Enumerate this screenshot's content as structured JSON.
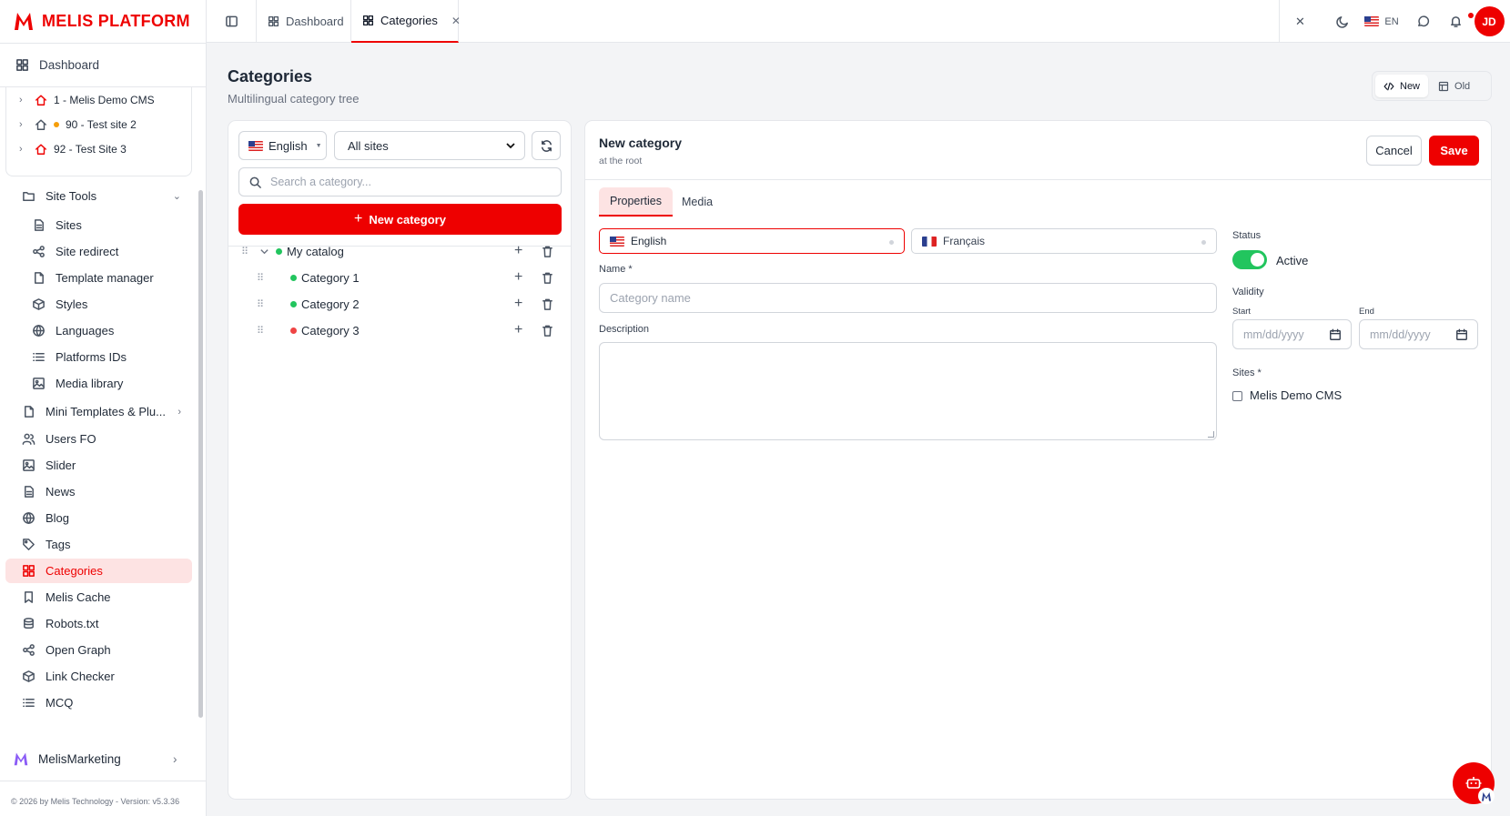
{
  "app": {
    "brand": "MELIS PLATFORM",
    "accent": "#ee0000"
  },
  "sidebar": {
    "dashboard": "Dashboard",
    "sites": [
      {
        "label": "1 - Melis Demo CMS",
        "icon": "home-icon",
        "color": "#e00"
      },
      {
        "label": "90 - Test site 2",
        "icon": "home-icon",
        "color": "#4b5563",
        "badge": "orange-dot"
      },
      {
        "label": "92 - Test Site 3",
        "icon": "home-icon",
        "color": "#e00"
      }
    ],
    "site_tools": "Site Tools",
    "site_tools_items": [
      "Sites",
      "Site redirect",
      "Template manager",
      "Styles",
      "Languages",
      "Platforms IDs",
      "Media library"
    ],
    "items": [
      "Mini Templates & Plu...",
      "Users FO",
      "Slider",
      "News",
      "Blog",
      "Tags",
      "Categories",
      "Melis Cache",
      "Robots.txt",
      "Open Graph",
      "Link Checker",
      "MCQ"
    ],
    "active_item": "Categories",
    "marketing": "MelisMarketing",
    "footer": "© 2026 by Melis Technology - Version: v5.3.36"
  },
  "topbar": {
    "tabs": [
      {
        "label": "Dashboard"
      },
      {
        "label": "Categories"
      }
    ],
    "language": "EN"
  },
  "user": {
    "initials": "JD"
  },
  "page": {
    "title": "Categories",
    "subtitle": "Multilingual category tree",
    "view_toggle": {
      "new": "New",
      "old": "Old",
      "selected": "New"
    }
  },
  "tree_panel": {
    "language": "English",
    "site_filter": "All sites",
    "site_options": [
      "All sites"
    ],
    "search_placeholder": "Search a category...",
    "new_button": "New category",
    "tree": [
      {
        "label": "My catalog",
        "status": "active",
        "level": 0
      },
      {
        "label": "Category 1",
        "status": "active",
        "level": 1
      },
      {
        "label": "Category 2",
        "status": "active",
        "level": 1
      },
      {
        "label": "Category 3",
        "status": "inactive",
        "level": 1
      }
    ]
  },
  "form": {
    "title": "New category",
    "subtitle": "at the root",
    "cancel": "Cancel",
    "save": "Save",
    "tabs": [
      "Properties",
      "Media"
    ],
    "active_tab": "Properties",
    "languages": [
      "English",
      "Français"
    ],
    "active_language": "English",
    "name_label": "Name *",
    "name_placeholder": "Category name",
    "description_label": "Description",
    "status_label": "Status",
    "status_value": "Active",
    "status_on": true,
    "validity_label": "Validity",
    "start_label": "Start",
    "end_label": "End",
    "date_placeholder": "mm/dd/yyyy",
    "sites_label": "Sites *",
    "sites": [
      {
        "label": "Melis Demo CMS",
        "checked": false
      }
    ]
  },
  "colors": {
    "status_active": "#22c55e",
    "status_inactive": "#ef4444",
    "switch_on": "#22c55e"
  }
}
